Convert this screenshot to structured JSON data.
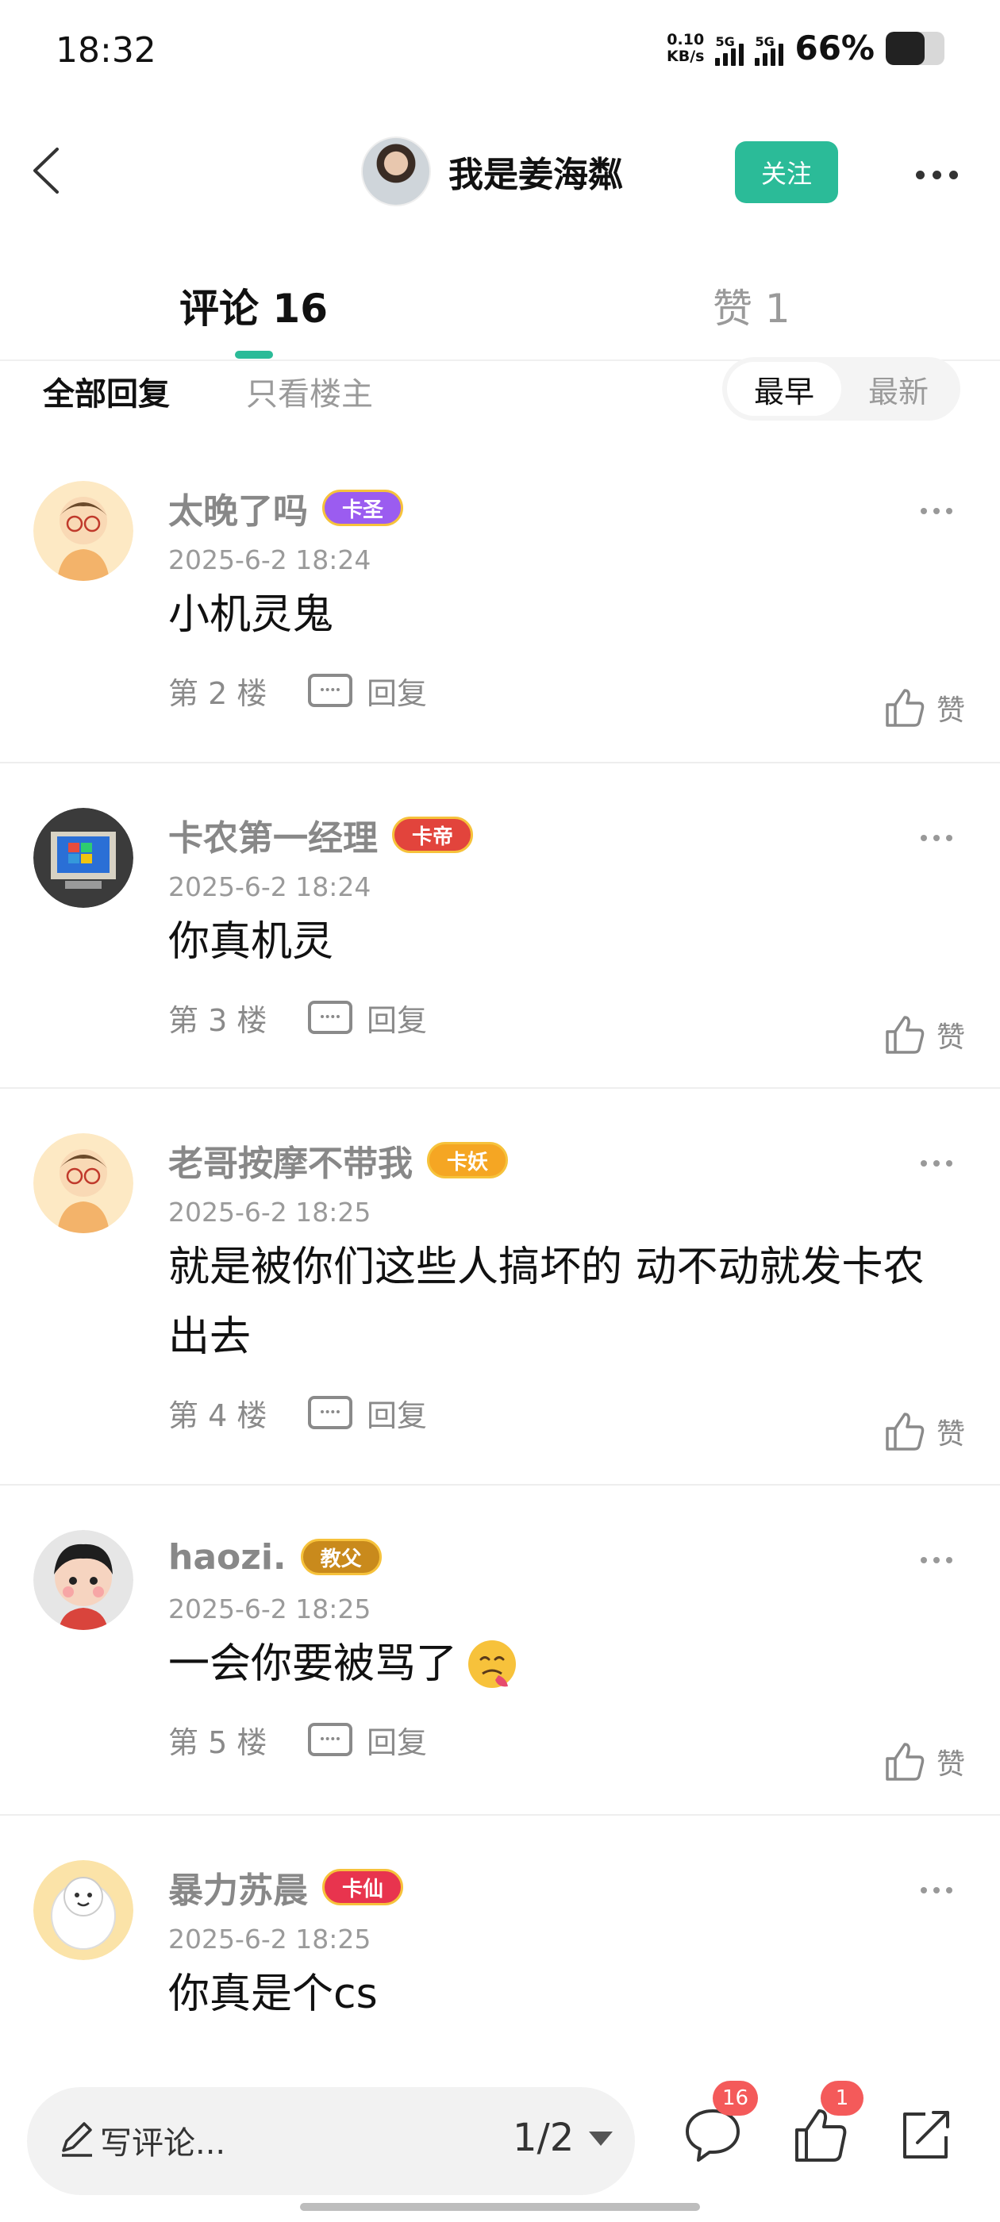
{
  "status_bar": {
    "time": "18:32",
    "net_speed_value": "0.10",
    "net_speed_unit": "KB/s",
    "signal_1_label": "5G",
    "signal_2_label": "5G",
    "battery_percent": "66%",
    "battery_level": 0.66
  },
  "header": {
    "username": "我是姜海粼",
    "follow_label": "关注"
  },
  "tabs": {
    "comments_label": "评论 16",
    "likes_label": "赞 1"
  },
  "filter": {
    "all_label": "全部回复",
    "owner_only_label": "只看楼主",
    "sort_earliest": "最早",
    "sort_latest": "最新"
  },
  "comments": [
    {
      "name": "太晚了吗",
      "badge": "卡圣",
      "badge_color": "#9b5cf0",
      "time": "2025-6-2 18:24",
      "text": "小机灵鬼",
      "floor": "第 2 楼",
      "reply": "回复",
      "like": "赞"
    },
    {
      "name": "卡农第一经理",
      "badge": "卡帝",
      "badge_color": "#e2443c",
      "time": "2025-6-2 18:24",
      "text": "你真机灵",
      "floor": "第 3 楼",
      "reply": "回复",
      "like": "赞"
    },
    {
      "name": "老哥按摩不带我",
      "badge": "卡妖",
      "badge_color": "#f5a623",
      "time": "2025-6-2 18:25",
      "text": "就是被你们这些人搞坏的 动不动就发卡农出去",
      "floor": "第 4 楼",
      "reply": "回复",
      "like": "赞"
    },
    {
      "name": "haozi.",
      "badge": "教父",
      "badge_color": "#c98a1c",
      "time": "2025-6-2 18:25",
      "text": "一会你要被骂了",
      "floor": "第 5 楼",
      "reply": "回复",
      "like": "赞"
    },
    {
      "name": "暴力苏晨",
      "badge": "卡仙",
      "badge_color": "#e8344e",
      "time": "2025-6-2 18:25",
      "text": "你真是个cs",
      "floor": "",
      "reply": "",
      "like": ""
    }
  ],
  "bottom_bar": {
    "write_placeholder": "写评论...",
    "page_indicator": "1/2",
    "comment_badge": "16",
    "like_badge": "1"
  }
}
